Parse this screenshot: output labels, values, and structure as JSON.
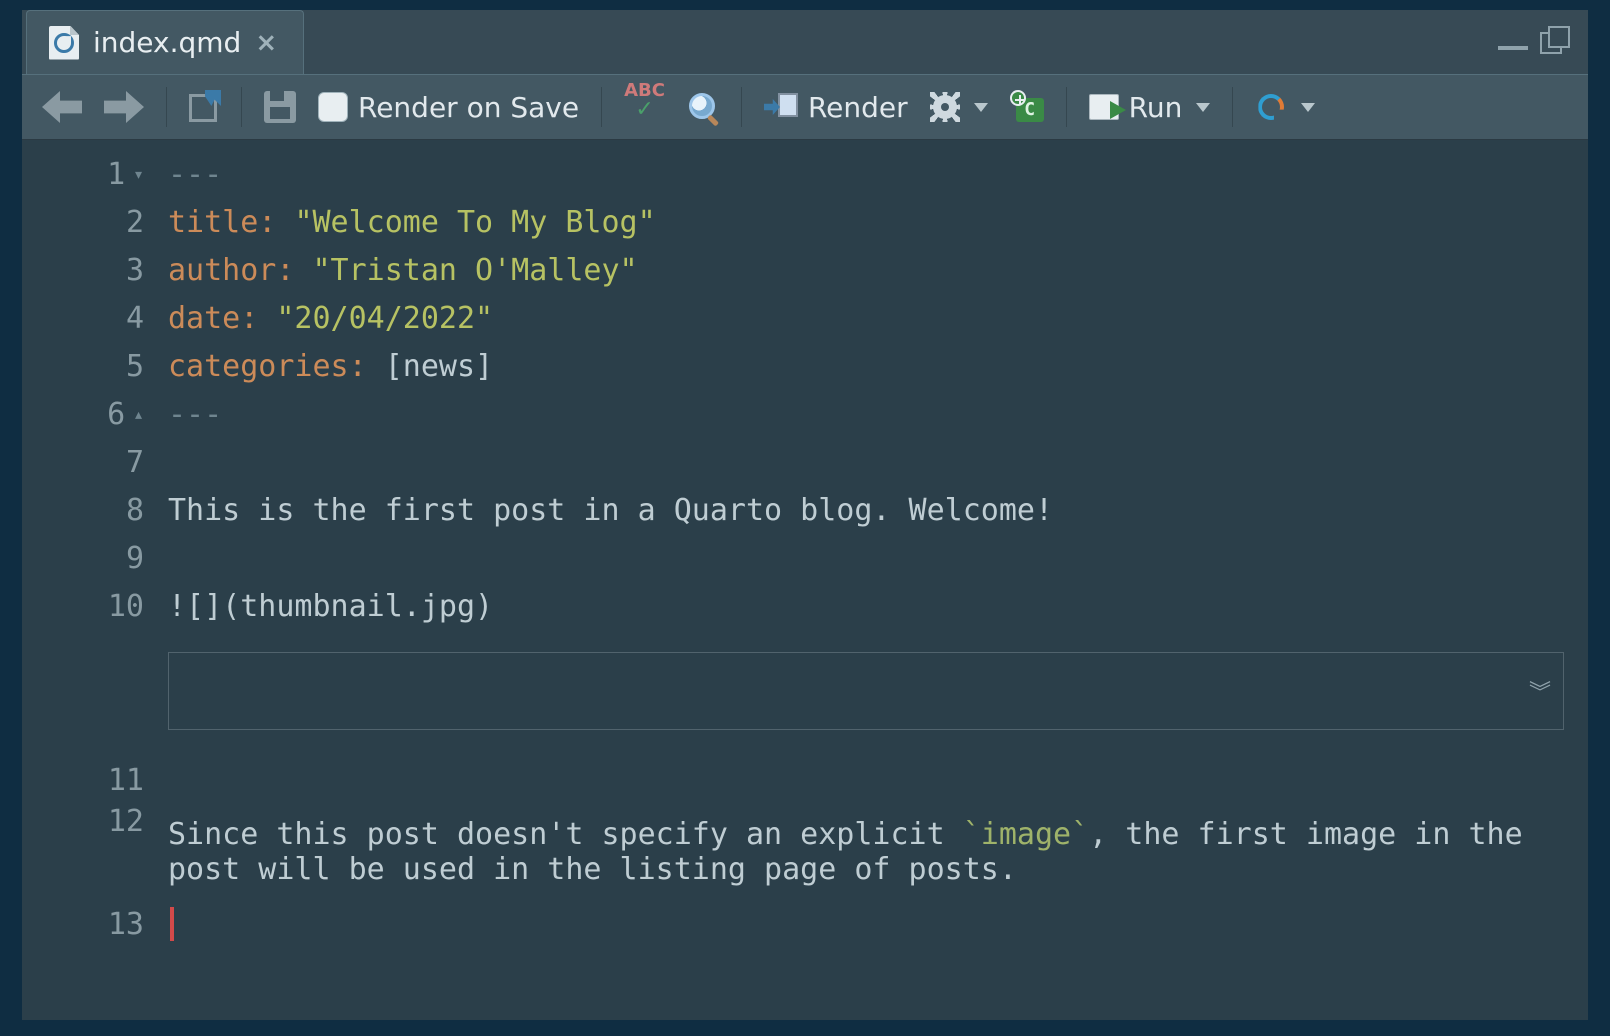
{
  "tab": {
    "filename": "index.qmd",
    "close_glyph": "×"
  },
  "windowcontrols": {
    "min": "–",
    "max": "❐"
  },
  "toolbar": {
    "render_on_save": "Render on Save",
    "render": "Render",
    "run": "Run"
  },
  "gutter": {
    "lines": [
      "1",
      "2",
      "3",
      "4",
      "5",
      "6",
      "7",
      "8",
      "9",
      "10",
      "11",
      "12",
      "13"
    ],
    "fold_down": "▾",
    "fold_up": "▴"
  },
  "code": {
    "l1": "---",
    "l2_key": "title:",
    "l2_val": "\"Welcome To My Blog\"",
    "l3_key": "author:",
    "l3_val": "\"Tristan O'Malley\"",
    "l4_key": "date:",
    "l4_val": "\"20/04/2022\"",
    "l5_key": "categories:",
    "l5_val": "[news]",
    "l6": "---",
    "l7": "",
    "l8": "This is the first post in a Quarto blog. Welcome!",
    "l9": "",
    "l10": "![](thumbnail.jpg)",
    "l11": "",
    "l12a": "Since this post doesn't specify an explicit ",
    "l12code": "`image`",
    "l12b": ", the first image in the post will be used in the listing page of posts.",
    "l13": ""
  },
  "chunk_expand_glyph": "︾"
}
